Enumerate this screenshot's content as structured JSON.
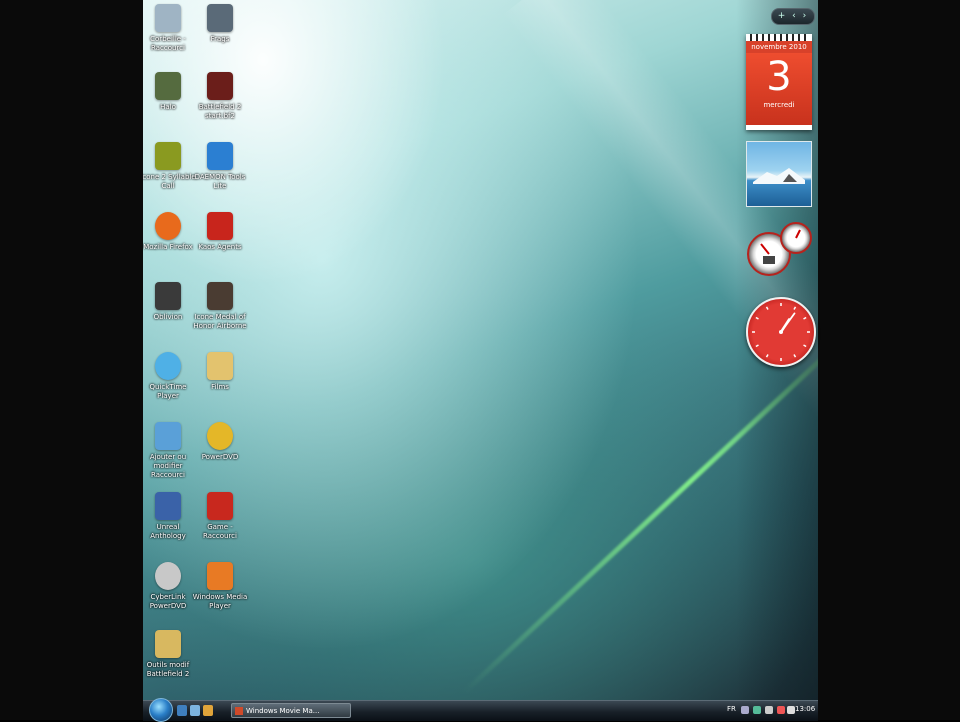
{
  "desktop": {
    "icons": [
      {
        "label": "Corbeille - Raccourci",
        "color": "#9fb4c4"
      },
      {
        "label": "Frags",
        "color": "#5a6a78"
      },
      {
        "label": "Halo",
        "color": "#556b3f"
      },
      {
        "label": "Battlefield 2 start.bf2",
        "color": "#6b1e1a"
      },
      {
        "label": "Icone 2 Syllable Call",
        "color": "#8a9a20"
      },
      {
        "label": "DAEMON Tools Lite",
        "color": "#2b7fd2"
      },
      {
        "label": "Mozilla Firefox",
        "color": "#e86a1c"
      },
      {
        "label": "Kaos Agents",
        "color": "#c8251c"
      },
      {
        "label": "Oblivion",
        "color": "#3a3a3a"
      },
      {
        "label": "Icone Medal of Honor Airborne",
        "color": "#4a3c32"
      },
      {
        "label": "QuickTime Player",
        "color": "#4fb0e6"
      },
      {
        "label": "Films",
        "color": "#e3c36e"
      },
      {
        "label": "Ajouter ou modifier Raccourci",
        "color": "#5aa0d8"
      },
      {
        "label": "PowerDVD",
        "color": "#e4b728"
      },
      {
        "label": "Unreal Anthology",
        "color": "#3a62a8"
      },
      {
        "label": "Game - Raccourci",
        "color": "#c8281e"
      },
      {
        "label": "CyberLink PowerDVD",
        "color": "#c8c8c8"
      },
      {
        "label": "Windows Media Player",
        "color": "#e87a24"
      },
      {
        "label": "Outils modif Battlefield 2",
        "color": "#d8b860"
      }
    ]
  },
  "sidebar": {
    "controls": "+ ‹ ›",
    "calendar": {
      "month": "novembre 2010",
      "day": "3",
      "weekday": "mercredi"
    },
    "clock": {
      "hour": 1,
      "minute": 6
    }
  },
  "taskbar": {
    "task_label": "Windows Movie Ma...",
    "lang": "FR",
    "time": "13:06"
  },
  "colors": {
    "accent": "#d8412a",
    "taskbar": "#182028"
  }
}
